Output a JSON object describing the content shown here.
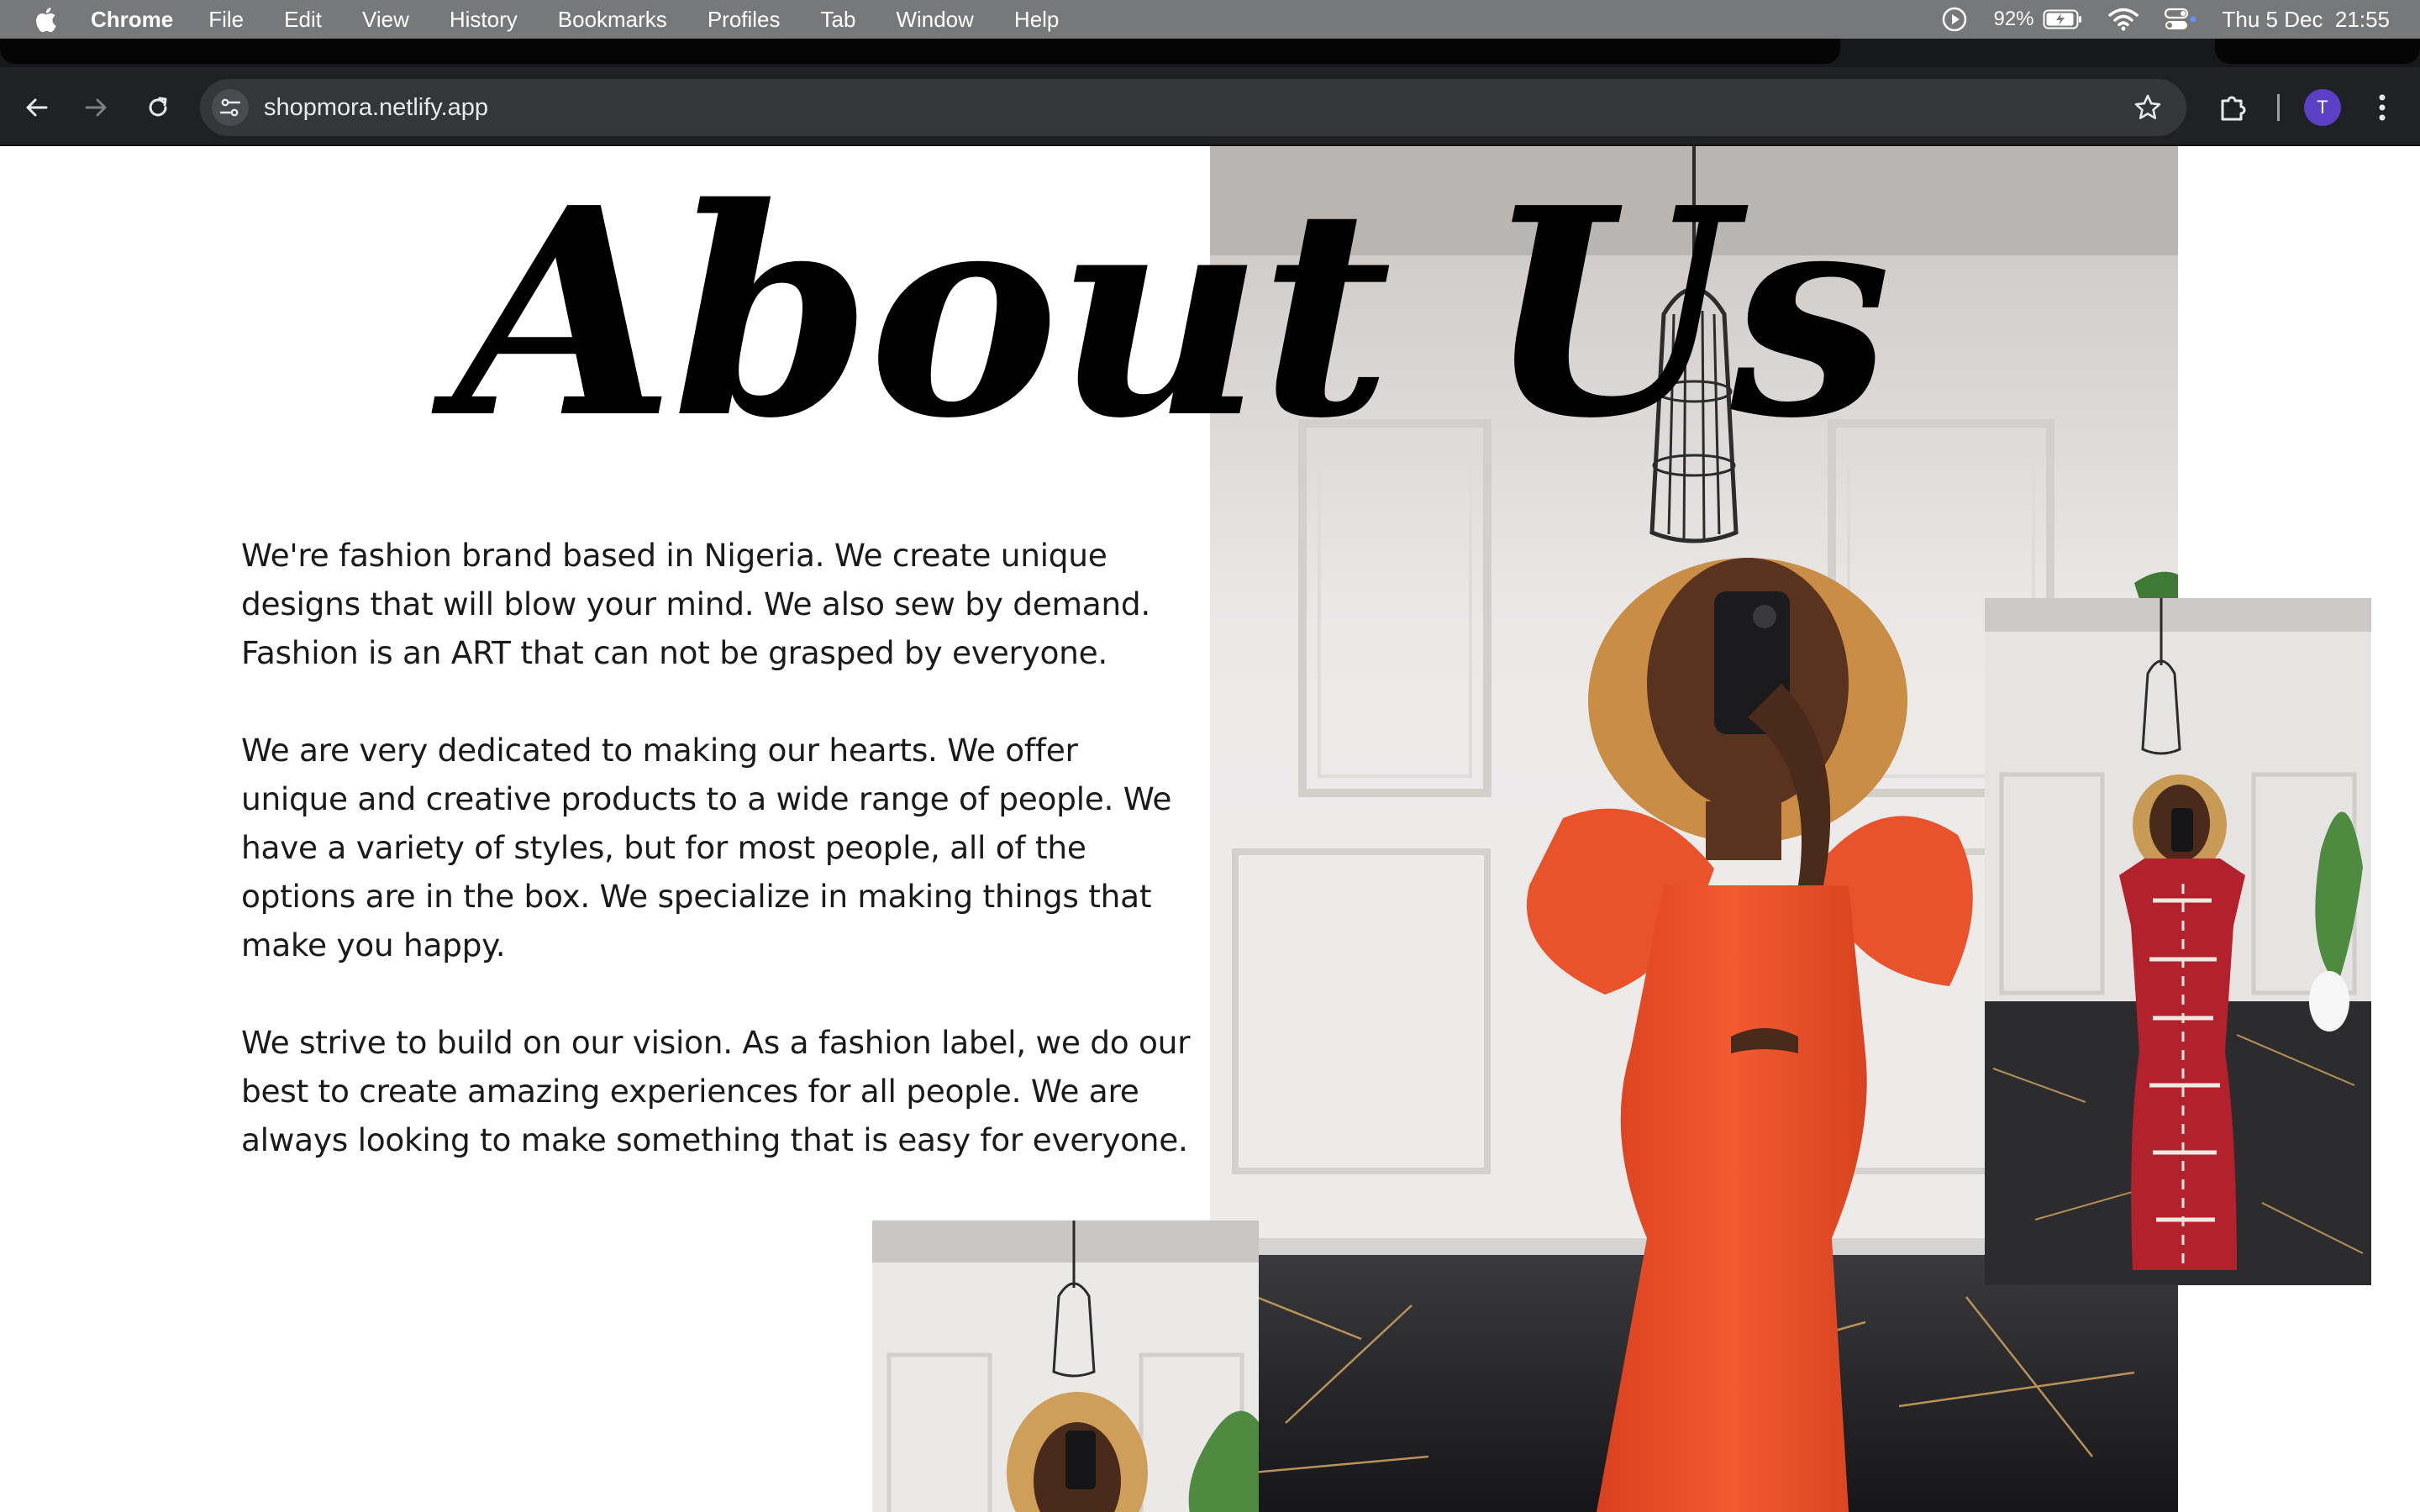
{
  "menubar": {
    "app_name": "Chrome",
    "menus": [
      "File",
      "Edit",
      "View",
      "History",
      "Bookmarks",
      "Profiles",
      "Tab",
      "Window",
      "Help"
    ],
    "battery": "92%",
    "datetime": "Thu 5 Dec  21:55"
  },
  "browser": {
    "url": "shopmora.netlify.app",
    "profile_initial": "T"
  },
  "page": {
    "title": "About Us",
    "paragraphs": [
      "We're fashion brand based in Nigeria. We create unique designs that will blow your mind. We also sew by demand. Fashion is an ART that can not be grasped by everyone.",
      "We are very dedicated to making our hearts. We offer unique and creative products to a wide range of people. We have a variety of styles, but for most people, all of the options are in the box. We specialize in making things that make you happy.",
      "We strive to build on our vision. As a fashion label, we do our best to create amazing experiences for all people. We are always looking to make something that is easy for everyone."
    ]
  },
  "colors": {
    "menubar": "#77787a",
    "toolbar": "#202124",
    "dress_orange": "#f0522a",
    "dress_red": "#b3222c"
  }
}
